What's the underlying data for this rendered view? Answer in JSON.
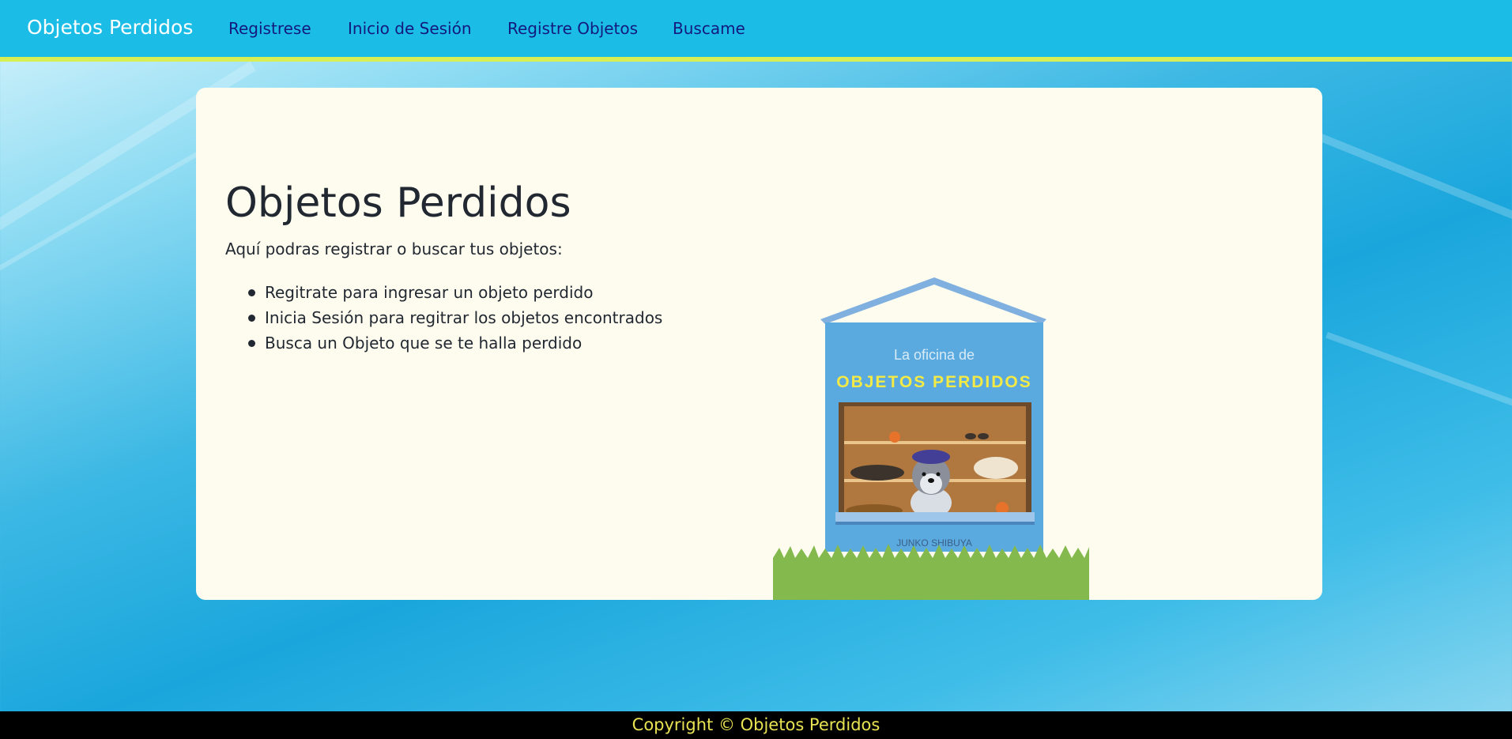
{
  "navbar": {
    "brand": "Objetos Perdidos",
    "links": [
      "Registrese",
      "Inicio de Sesión",
      "Registre Objetos",
      "Buscame"
    ]
  },
  "hero": {
    "title": "Objetos Perdidos",
    "lead": "Aquí podras registrar o buscar tus objetos:",
    "items": [
      "Regitrate para ingresar un objeto perdido",
      "Inicia Sesión para regitrar los objetos encontrados",
      "Busca un Objeto que se te halla perdido"
    ]
  },
  "illustration": {
    "kicker": "La oficina de",
    "title": "OBJETOS PERDIDOS",
    "author": "JUNKO SHIBUYA"
  },
  "footer": {
    "text": "Copyright © Objetos Perdidos"
  },
  "colors": {
    "navbar": "#1bbde6",
    "nav_accent": "#d7ef55",
    "nav_link": "#14197e",
    "card": "#fefcee",
    "footer_text": "#e7e352"
  }
}
